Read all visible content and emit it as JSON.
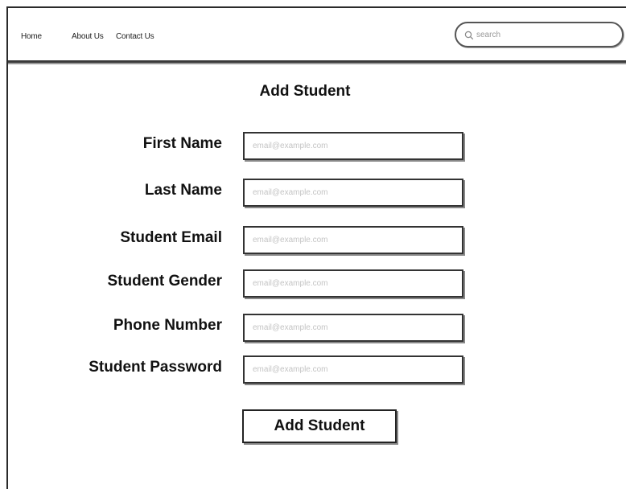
{
  "nav": {
    "links": [
      {
        "label": "Home"
      },
      {
        "label": "About Us"
      },
      {
        "label": "Contact Us"
      }
    ],
    "search": {
      "placeholder": "search",
      "value": ""
    }
  },
  "page": {
    "title": "Add Student"
  },
  "form": {
    "fields": [
      {
        "label": "First Name",
        "placeholder": "email@example.com",
        "value": ""
      },
      {
        "label": "Last Name",
        "placeholder": "email@example.com",
        "value": ""
      },
      {
        "label": "Student Email",
        "placeholder": "email@example.com",
        "value": ""
      },
      {
        "label": "Student Gender",
        "placeholder": "email@example.com",
        "value": ""
      },
      {
        "label": "Phone Number",
        "placeholder": "email@example.com",
        "value": ""
      },
      {
        "label": "Student Password",
        "placeholder": "email@example.com",
        "value": ""
      }
    ],
    "submit_label": "Add Student"
  },
  "icons": {
    "search": "search-icon"
  }
}
